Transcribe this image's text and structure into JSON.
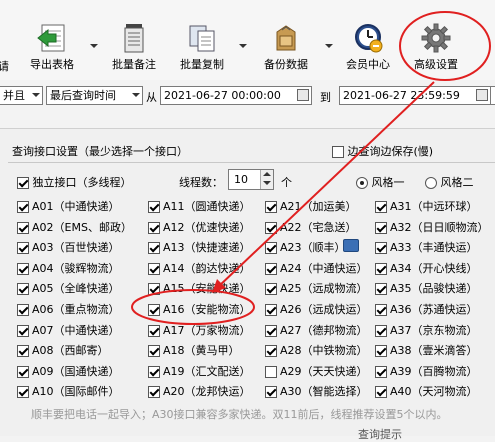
{
  "toolbar": {
    "items": [
      {
        "label": "请"
      },
      {
        "label": "导出表格",
        "icon": "export-table-icon"
      },
      {
        "label": "批量备注",
        "icon": "batch-note-icon"
      },
      {
        "label": "批量复制",
        "icon": "batch-copy-icon"
      },
      {
        "label": "备份数据",
        "icon": "backup-data-icon"
      },
      {
        "label": "会员中心",
        "icon": "member-center-icon"
      },
      {
        "label": "高级设置",
        "icon": "gear-icon"
      }
    ]
  },
  "filter": {
    "combo1": "并且",
    "combo2": "最后查询时间",
    "from_label": "从",
    "from_value": "2021-06-27 00:00:00",
    "to_label": "到",
    "to_value": "2021-06-27 23:59:59"
  },
  "panel": {
    "title": "查询接口设置（最少选择一个接口）",
    "save_label": "边查询边保存(慢)",
    "independent_label": "独立接口（多线程）",
    "thread_label": "线程数：",
    "thread_value": "10",
    "thread_unit": "个",
    "style1": "风格一",
    "style2": "风格二",
    "note": "顺丰要把电话一起导入；A30接口兼容多家快递。双11前后，线程推荐设置5个以内。",
    "bottom_right": "查询提示"
  },
  "interfaces": [
    [
      "A01（中通快递）",
      "A11（圆通快递）",
      "A21（加运美）",
      "A31（中远环球）"
    ],
    [
      "A02（EMS、邮政）",
      "A12（优速快递）",
      "A22（宅急送）",
      "A32（日日顺物流）"
    ],
    [
      "A03（百世快递）",
      "A13（快捷速递）",
      "A23（顺丰）",
      "A33（丰通快运）"
    ],
    [
      "A04（骏辉物流）",
      "A14（韵达快递）",
      "A24（中通快运）",
      "A34（开心快线）"
    ],
    [
      "A05（全峰快递）",
      "A15（安能快递）",
      "A25（远成物流）",
      "A35（品骏快递）"
    ],
    [
      "A06（重点物流）",
      "A16（安能物流）",
      "A26（远成快运）",
      "A36（苏通快运）"
    ],
    [
      "A07（中通快递）",
      "A17（万家物流）",
      "A27（德邦物流）",
      "A37（京东物流）"
    ],
    [
      "A08（西邮寄）",
      "A18（黄马甲）",
      "A28（中铁物流）",
      "A38（壹米滴答）"
    ],
    [
      "A09（国通快递）",
      "A19（汇文配送）",
      "A29（天天快递）",
      "A39（百腾物流）"
    ],
    [
      "A10（国际邮件）",
      "A20（龙邦快运）",
      "A30（智能选择）",
      "A40（天河物流）"
    ]
  ],
  "colors": {
    "annotation": "#e02020",
    "panel_bg": "#f0f0f0"
  }
}
